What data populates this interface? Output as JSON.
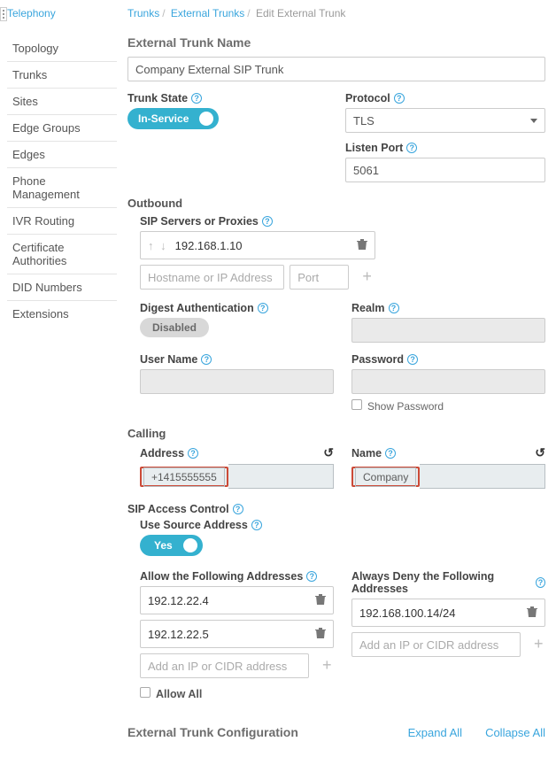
{
  "breadcrumb": {
    "telephony": "Telephony",
    "trunks": "Trunks",
    "external": "External Trunks",
    "edit": "Edit External Trunk"
  },
  "sidebar": {
    "items": [
      {
        "label": "Topology"
      },
      {
        "label": "Trunks"
      },
      {
        "label": "Sites"
      },
      {
        "label": "Edge Groups"
      },
      {
        "label": "Edges"
      },
      {
        "label": "Phone Management"
      },
      {
        "label": "IVR Routing"
      },
      {
        "label": "Certificate Authorities"
      },
      {
        "label": "DID Numbers"
      },
      {
        "label": "Extensions"
      }
    ]
  },
  "headings": {
    "name": "External Trunk Name",
    "outbound": "Outbound",
    "calling": "Calling",
    "config": "External Trunk Configuration"
  },
  "labels": {
    "trunkState": "Trunk State",
    "protocol": "Protocol",
    "listenPort": "Listen Port",
    "sipServers": "SIP Servers or Proxies",
    "digestAuth": "Digest Authentication",
    "realm": "Realm",
    "userName": "User Name",
    "password": "Password",
    "showPassword": "Show Password",
    "address": "Address",
    "nameLbl": "Name",
    "sipAccess": "SIP Access Control",
    "useSource": "Use Source Address",
    "allowFollowing": "Allow the Following Addresses",
    "denyFollowing": "Always Deny the Following Addresses",
    "allowAll": "Allow All"
  },
  "placeholders": {
    "host": "Hostname or IP Address",
    "port": "Port",
    "cidr": "Add an IP or CIDR address"
  },
  "values": {
    "trunkName": "Company External SIP Trunk",
    "trunkState": "In-Service",
    "protocol": "TLS",
    "listenPort": "5061",
    "sipServer": "192.168.1.10",
    "digest": "Disabled",
    "useSource": "Yes",
    "address": "+1415555555",
    "callingName": "Company",
    "allow": [
      "192.12.22.4",
      "192.12.22.5"
    ],
    "deny": [
      "192.168.100.14/24"
    ]
  },
  "actions": {
    "expand": "Expand All",
    "collapse": "Collapse All"
  }
}
